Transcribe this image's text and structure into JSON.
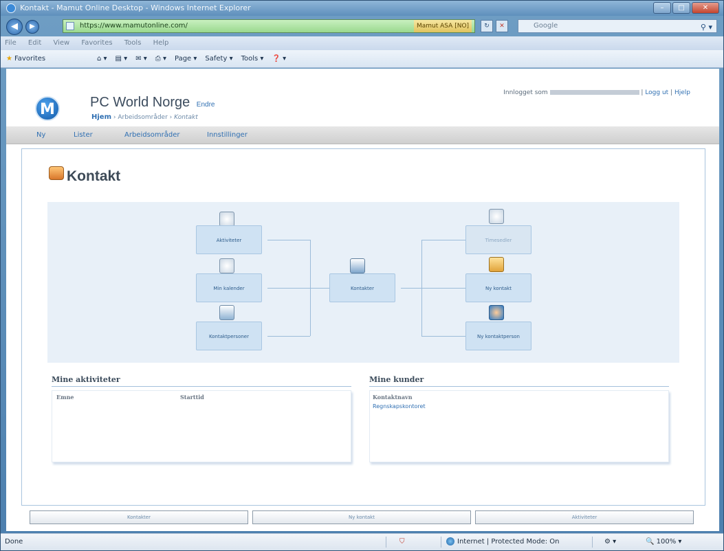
{
  "window": {
    "title": "Kontakt - Mamut Online Desktop - Windows Internet Explorer",
    "url": "https://www.mamutonline.com/",
    "certificate": "Mamut ASA [NO]",
    "search_placeholder": "Google"
  },
  "menubar": [
    "File",
    "Edit",
    "View",
    "Favorites",
    "Tools",
    "Help"
  ],
  "favbar": {
    "favorites_label": "Favorites",
    "tools": [
      "Page ▾",
      "Safety ▾",
      "Tools ▾"
    ]
  },
  "header": {
    "company": "PC World Norge",
    "edit_link": "Endre",
    "breadcrumb": {
      "home": "Hjem",
      "area": "Arbeidsområder",
      "current": "Kontakt"
    },
    "logged_in_prefix": "Innlogget som",
    "logout": "Logg ut",
    "help": "Hjelp"
  },
  "nav": [
    "Ny",
    "Lister",
    "Arbeidsområder",
    "Innstillinger"
  ],
  "page": {
    "title": "Kontakt"
  },
  "diagram": {
    "left": [
      "Aktiviteter",
      "Min kalender",
      "Kontaktpersoner"
    ],
    "center": "Kontakter",
    "right": [
      "Timesedler",
      "Ny kontakt",
      "Ny kontaktperson"
    ]
  },
  "activities": {
    "title": "Mine aktiviteter",
    "columns": [
      "Emne",
      "Starttid"
    ]
  },
  "customers": {
    "title": "Mine kunder",
    "column": "Kontaktnavn",
    "rows": [
      "Regnskapskontoret"
    ]
  },
  "bottom_buttons": [
    "Kontakter",
    "Ny kontakt",
    "Aktiviteter"
  ],
  "statusbar": {
    "done": "Done",
    "zone": "Internet | Protected Mode: On",
    "zoom": "100%"
  }
}
